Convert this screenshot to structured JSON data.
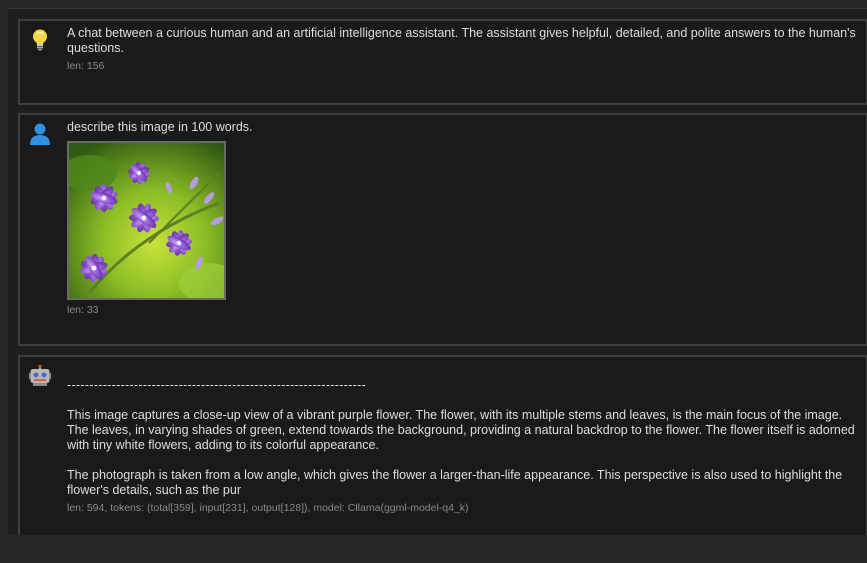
{
  "conversation": {
    "system": {
      "icon": "lightbulb-icon",
      "text": "A chat between a curious human and an artificial intelligence assistant. The assistant gives helpful, detailed, and polite answers to the human's questions.",
      "meta": "len: 156"
    },
    "user": {
      "icon": "user-icon",
      "text": "describe this image in 100 words.",
      "image_alt": "purple flowers",
      "meta": "len: 33"
    },
    "assistant": {
      "icon": "robot-icon",
      "separator": "-------------------------------------------------------------------",
      "paragraph1": "This image captures a close-up view of a vibrant purple flower. The flower, with its multiple stems and leaves, is the main focus of the image. The leaves, in varying shades of green, extend towards the background, providing a natural backdrop to the flower. The flower itself is adorned with tiny white flowers, adding to its colorful appearance.",
      "paragraph2": "The photograph is taken from a low angle, which gives the flower a larger-than-life appearance. This perspective is also used to highlight the flower's details, such as the pur",
      "meta": "len: 594, tokens: (total[359], input[231], output[128]), model: Cllama(ggml-model-q4_k)"
    }
  },
  "colors": {
    "background": "#1e1e1e",
    "card": "#1a1a1a",
    "border": "#3e3e3e",
    "text": "#dedede",
    "meta": "#8a8a8a"
  }
}
